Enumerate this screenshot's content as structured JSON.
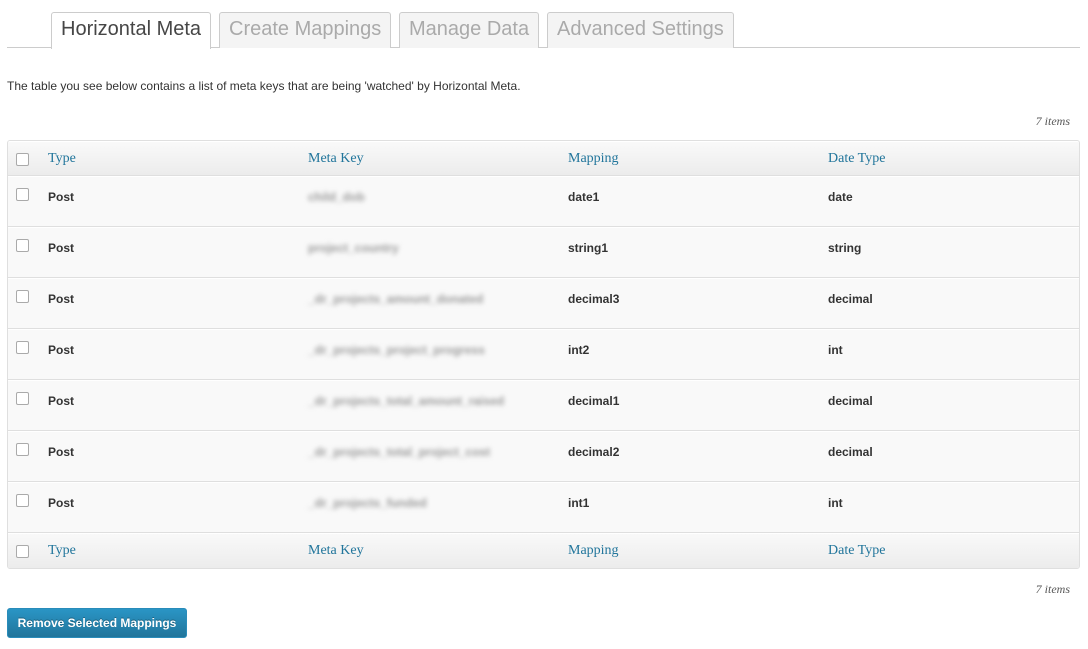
{
  "tabs": [
    "Horizontal Meta",
    "Create Mappings",
    "Manage Data",
    "Advanced Settings"
  ],
  "intro": "The table you see below contains a list of meta keys that are being 'watched' by Horizontal Meta.",
  "item_count": "7 items",
  "columns": [
    "Type",
    "Meta Key",
    "Mapping",
    "Date Type"
  ],
  "rows": [
    {
      "type": "Post",
      "meta_key": "child_dob",
      "mapping": "date1",
      "date_type": "date"
    },
    {
      "type": "Post",
      "meta_key": "project_country",
      "mapping": "string1",
      "date_type": "string"
    },
    {
      "type": "Post",
      "meta_key": "_dr_projects_amount_donated",
      "mapping": "decimal3",
      "date_type": "decimal"
    },
    {
      "type": "Post",
      "meta_key": "_dr_projects_project_progress",
      "mapping": "int2",
      "date_type": "int"
    },
    {
      "type": "Post",
      "meta_key": "_dr_projects_total_amount_raised",
      "mapping": "decimal1",
      "date_type": "decimal"
    },
    {
      "type": "Post",
      "meta_key": "_dr_projects_total_project_cost",
      "mapping": "decimal2",
      "date_type": "decimal"
    },
    {
      "type": "Post",
      "meta_key": "_dr_projects_funded",
      "mapping": "int1",
      "date_type": "int"
    }
  ],
  "remove_button": "Remove Selected Mappings"
}
